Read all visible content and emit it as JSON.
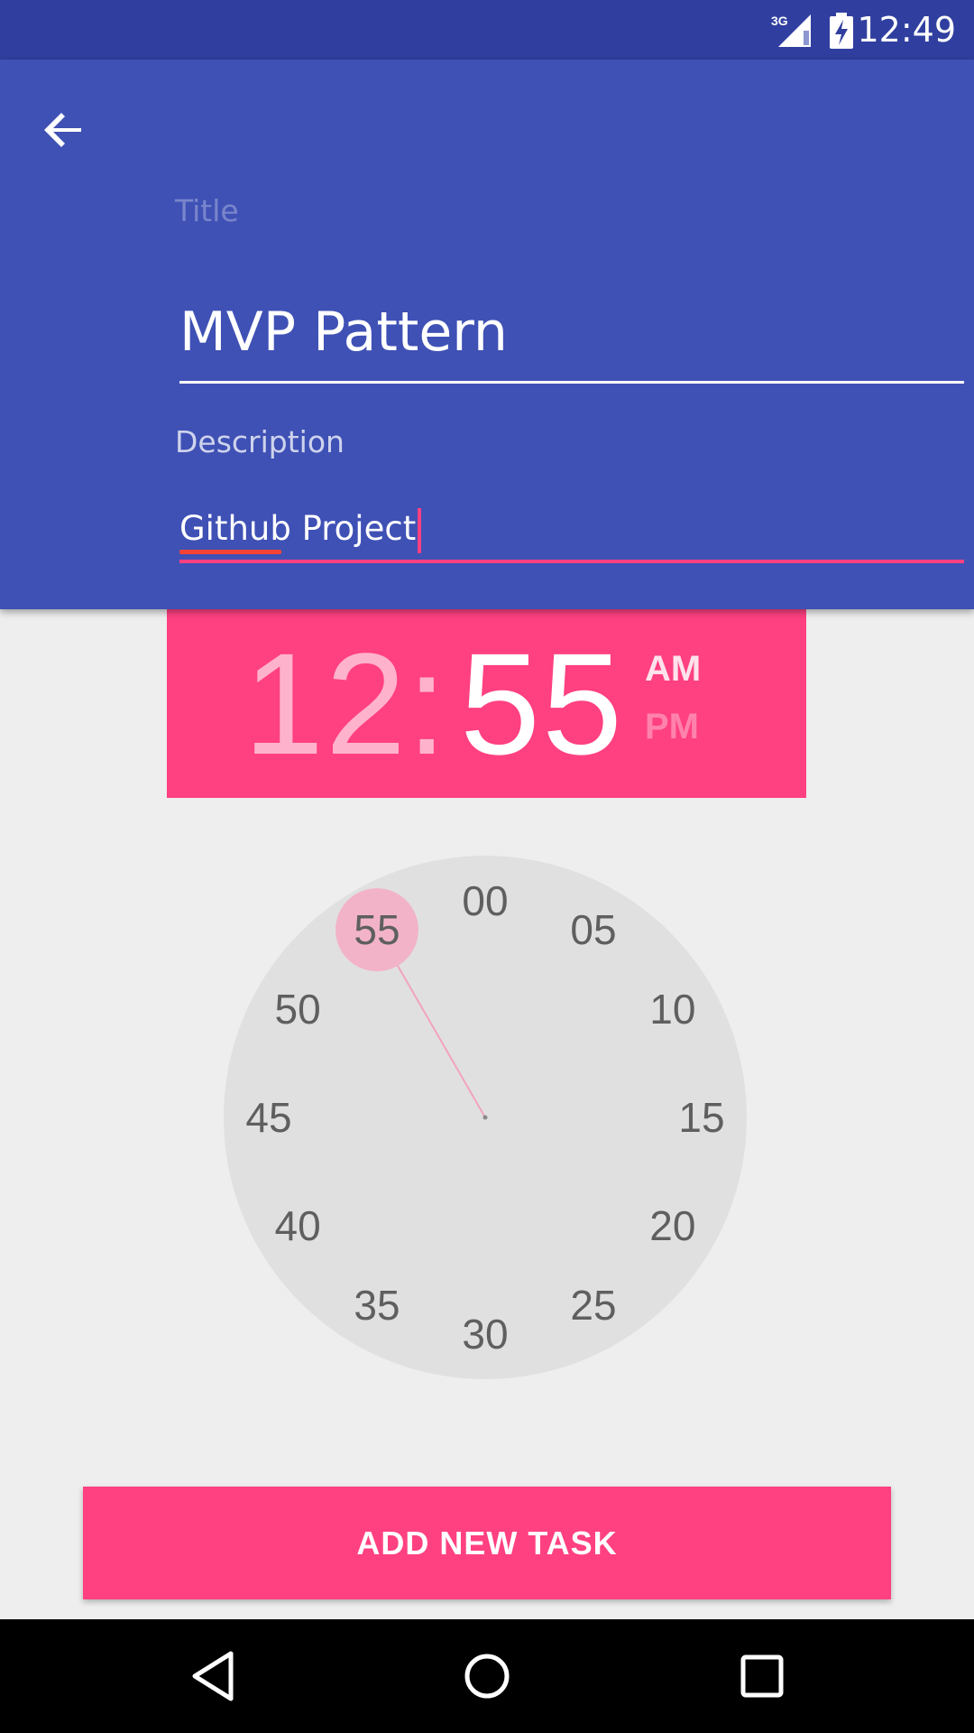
{
  "status_bar": {
    "time": "12:49",
    "network_label": "3G",
    "icons": [
      "signal-icon",
      "battery-charging-icon"
    ]
  },
  "header": {
    "back_icon": "arrow-back-icon",
    "title_label": "Title",
    "title_value": "MVP Pattern",
    "description_label": "Description",
    "description_value": "Github Project"
  },
  "time_picker": {
    "hours": "12",
    "separator": ":",
    "minutes": "55",
    "am": "AM",
    "pm": "PM",
    "selected_period": "AM",
    "selected_minute": "55",
    "dial_numbers": [
      "00",
      "05",
      "10",
      "15",
      "20",
      "25",
      "30",
      "35",
      "40",
      "45",
      "50",
      "55"
    ]
  },
  "actions": {
    "add_task_label": "ADD NEW TASK"
  },
  "colors": {
    "primary": "#3F51B5",
    "primary_dark": "#303F9F",
    "accent": "#FF4081",
    "background": "#EEEEEE",
    "dial_face": "#E0E0E0",
    "dial_selection": "#F2B3C8"
  },
  "nav_bar": {
    "icons": [
      "nav-back-icon",
      "nav-home-icon",
      "nav-recents-icon"
    ]
  }
}
